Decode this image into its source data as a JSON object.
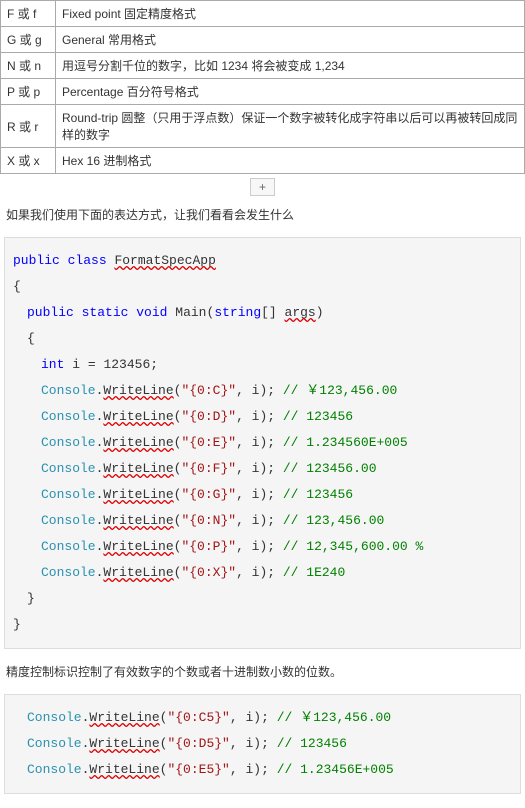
{
  "table": {
    "rows": [
      {
        "c1": "F 或 f",
        "c2": "Fixed point  固定精度格式"
      },
      {
        "c1": "G 或 g",
        "c2": "General  常用格式"
      },
      {
        "c1": "N 或 n",
        "c2": "用逗号分割千位的数字，比如 1234 将会被变成 1,234"
      },
      {
        "c1": "P 或 p",
        "c2": "Percentage  百分符号格式"
      },
      {
        "c1": "R 或 r",
        "c2": "Round-trip   圆整（只用于浮点数）保证一个数字被转化成字符串以后可以再被转回成同样的数字"
      },
      {
        "c1": "X 或 x",
        "c2": "Hex 16 进制格式"
      }
    ]
  },
  "plus_label": "+",
  "para1": "如果我们使用下面的表达方式，让我们看看会发生什么",
  "code1": {
    "kw_public": "public",
    "kw_class": "class",
    "cls_name": "FormatSpecApp",
    "kw_static": "static",
    "kw_void": "void",
    "main_name": "Main",
    "type_string_arr": "string",
    "args_name": "args",
    "kw_int": "int",
    "var_i": "i",
    "i_val": "123456",
    "console": "Console",
    "writeline": "WriteLine",
    "lines": [
      {
        "fmt": "\"{0:C}\"",
        "com": "// ￥123,456.00"
      },
      {
        "fmt": "\"{0:D}\"",
        "com": "// 123456"
      },
      {
        "fmt": "\"{0:E}\"",
        "com": "// 1.234560E+005"
      },
      {
        "fmt": "\"{0:F}\"",
        "com": "// 123456.00"
      },
      {
        "fmt": "\"{0:G}\"",
        "com": "// 123456"
      },
      {
        "fmt": "\"{0:N}\"",
        "com": "// 123,456.00"
      },
      {
        "fmt": "\"{0:P}\"",
        "com": "// 12,345,600.00 %"
      },
      {
        "fmt": "\"{0:X}\"",
        "com": "// 1E240"
      }
    ]
  },
  "para2": "精度控制标识控制了有效数字的个数或者十进制数小数的位数。",
  "code2": {
    "console": "Console",
    "writeline": "WriteLine",
    "lines": [
      {
        "fmt": "\"{0:C5}\"",
        "com": "// ￥123,456.00"
      },
      {
        "fmt": "\"{0:D5}\"",
        "com": "// 123456"
      },
      {
        "fmt": "\"{0:E5}\"",
        "com": "// 1.23456E+005"
      }
    ]
  }
}
